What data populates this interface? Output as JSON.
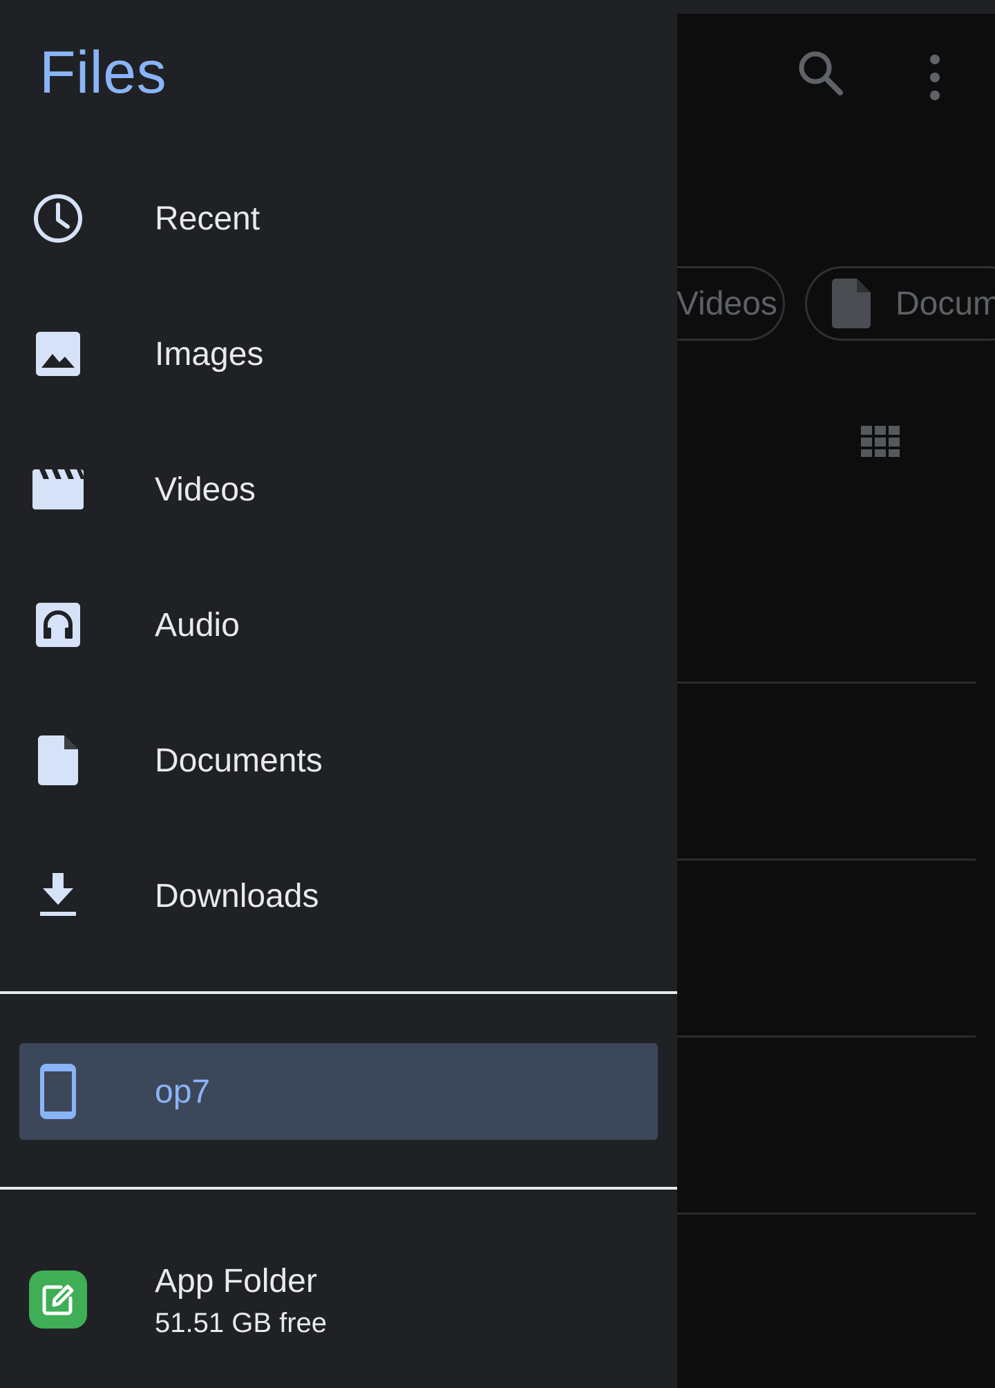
{
  "drawer": {
    "title": "Files",
    "items": [
      {
        "label": "Recent",
        "icon": "clock-icon"
      },
      {
        "label": "Images",
        "icon": "image-icon"
      },
      {
        "label": "Videos",
        "icon": "clapperboard-icon"
      },
      {
        "label": "Audio",
        "icon": "headphones-icon"
      },
      {
        "label": "Documents",
        "icon": "document-icon"
      },
      {
        "label": "Downloads",
        "icon": "download-icon"
      }
    ],
    "storage": {
      "label": "op7",
      "icon": "phone-icon",
      "selected": true
    },
    "app_folder": {
      "name": "App Folder",
      "free": "51.51 GB free",
      "icon": "edit-icon"
    }
  },
  "background": {
    "chips": [
      {
        "label": "Videos"
      },
      {
        "label": "Documents",
        "icon": "document-icon"
      }
    ]
  },
  "colors": {
    "accent": "#8ab4f8",
    "drawer_bg": "#202124",
    "selected_bg": "#3c4759",
    "app_icon_green": "#3fae56"
  }
}
